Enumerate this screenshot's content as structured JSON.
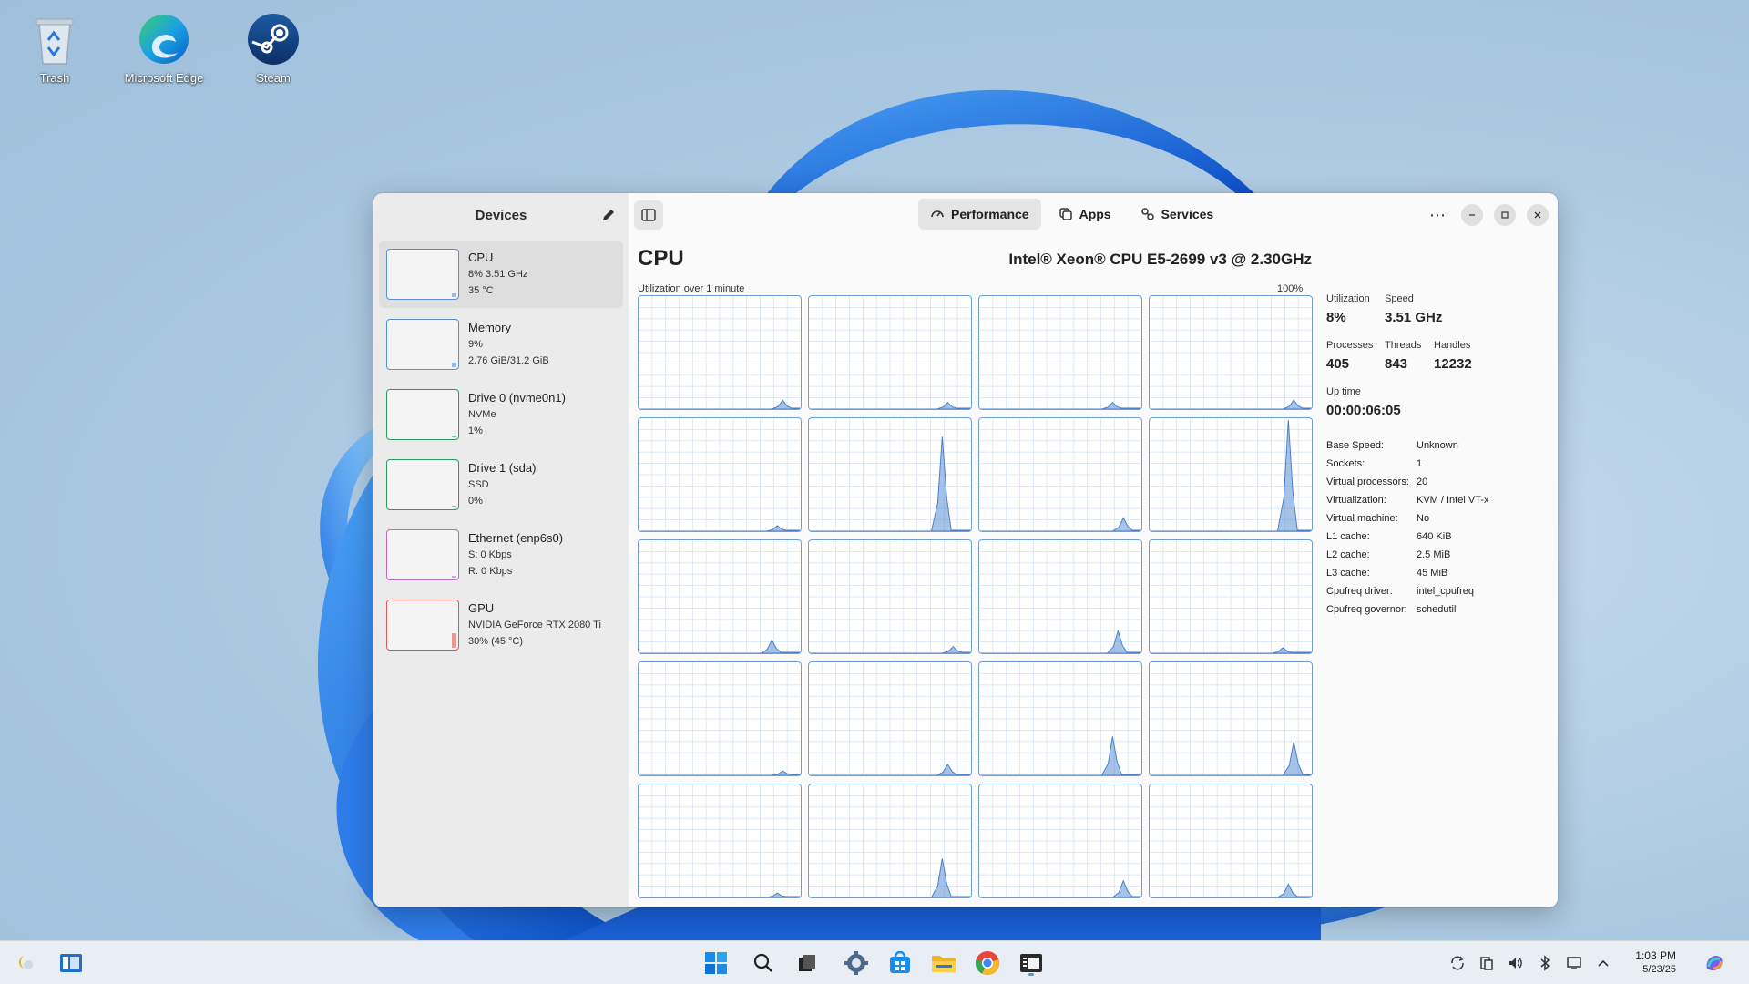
{
  "desktop": {
    "icons": [
      {
        "label": "Trash",
        "icon": "recycle-bin-icon"
      },
      {
        "label": "Microsoft Edge",
        "icon": "edge-icon"
      },
      {
        "label": "Steam",
        "icon": "steam-icon"
      }
    ]
  },
  "sidebar": {
    "title": "Devices",
    "edit_icon": "pencil-icon",
    "devices": [
      {
        "name": "CPU",
        "line1": "8% 3.51 GHz",
        "line2": "35 °C",
        "color": "#5b8fd4",
        "level": 0.08
      },
      {
        "name": "Memory",
        "line1": "9%",
        "line2": "2.76 GiB/31.2 GiB",
        "color": "#5b8fd4",
        "level": 0.09
      },
      {
        "name": "Drive 0 (nvme0n1)",
        "line1": "NVMe",
        "line2": "1%",
        "color": "#2e9b5c",
        "level": 0.01
      },
      {
        "name": "Drive 1 (sda)",
        "line1": "SSD",
        "line2": "0%",
        "color": "#2e9b5c",
        "level": 0
      },
      {
        "name": "Ethernet (enp6s0)",
        "line1": "S: 0 Kbps",
        "line2": "R: 0 Kbps",
        "color": "#c06ac6",
        "level": 0
      },
      {
        "name": "GPU",
        "line1": "NVIDIA GeForce RTX 2080 Ti",
        "line2": "30% (45 °C)",
        "color": "#e0584e",
        "level": 0.3
      }
    ]
  },
  "tabs": [
    {
      "label": "Performance",
      "icon": "gauge-icon",
      "active": true
    },
    {
      "label": "Apps",
      "icon": "apps-icon",
      "active": false
    },
    {
      "label": "Services",
      "icon": "services-icon",
      "active": false
    }
  ],
  "window_controls": {
    "menu": "⋯"
  },
  "cpu": {
    "title": "CPU",
    "model": "Intel® Xeon® CPU E5-2699 v3 @ 2.30GHz",
    "util_label": "Utilization over 1 minute",
    "util_max": "100%",
    "stats": {
      "utilization_label": "Utilization",
      "utilization": "8%",
      "speed_label": "Speed",
      "speed": "3.51 GHz",
      "processes_label": "Processes",
      "processes": "405",
      "threads_label": "Threads",
      "threads": "843",
      "handles_label": "Handles",
      "handles": "12232",
      "uptime_label": "Up time",
      "uptime": "00:00:06:05"
    },
    "details": [
      {
        "k": "Base Speed:",
        "v": "Unknown"
      },
      {
        "k": "Sockets:",
        "v": "1"
      },
      {
        "k": "Virtual processors:",
        "v": "20"
      },
      {
        "k": "Virtualization:",
        "v": "KVM / Intel VT-x"
      },
      {
        "k": "Virtual machine:",
        "v": "No"
      },
      {
        "k": "L1 cache:",
        "v": "640 KiB"
      },
      {
        "k": "L2 cache:",
        "v": "2.5 MiB"
      },
      {
        "k": "L3 cache:",
        "v": "45 MiB"
      },
      {
        "k": "Cpufreq driver:",
        "v": "intel_cpufreq"
      },
      {
        "k": "Cpufreq governor:",
        "v": "schedutil"
      }
    ],
    "core_peaks": [
      0.08,
      0.06,
      0.06,
      0.08,
      0.05,
      0.85,
      0.12,
      1.0,
      0.12,
      0.06,
      0.2,
      0.05,
      0.04,
      0.1,
      0.35,
      0.3,
      0.04,
      0.35,
      0.15,
      0.12
    ]
  },
  "taskbar": {
    "icons": [
      "widgets-icon",
      "task-view-icon",
      "start-icon",
      "search-icon",
      "file-manager-icon",
      "settings-icon",
      "store-icon",
      "explorer-icon",
      "chrome-icon",
      "task-manager-icon"
    ],
    "tray": [
      "sync-icon",
      "clipboard-icon",
      "volume-icon",
      "bluetooth-icon",
      "display-icon",
      "chevron-up-icon"
    ],
    "time": "1:03 PM",
    "date": "5/23/25",
    "copilot_icon": "copilot-icon"
  }
}
